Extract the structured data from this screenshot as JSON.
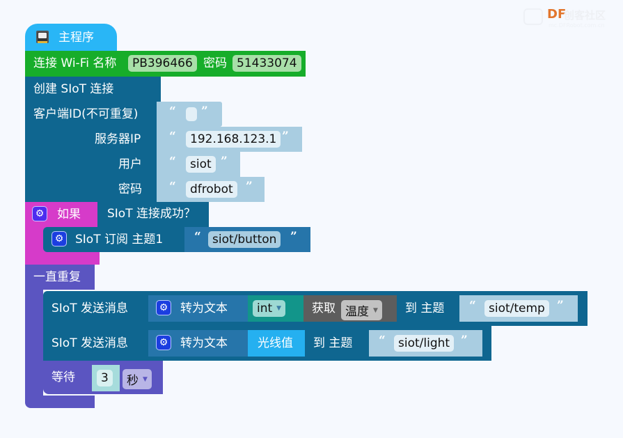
{
  "watermark": {
    "brand": "DF",
    "brand_cn": "创客社区",
    "url": "mc.DFRobot.com.cn",
    "brand_color": "#e2762d"
  },
  "program": {
    "main_label": "主程序",
    "main_icon": "microbit-board-icon",
    "wifi": {
      "prefix": "连接 Wi-Fi 名称",
      "ssid": "PB396466",
      "password_label": "密码",
      "password": "51433074"
    },
    "siot_connect": {
      "title": "创建 SIoT 连接",
      "client_id_label": "客户端ID(不可重复)",
      "client_id_value": "",
      "server_ip_label": "服务器IP",
      "server_ip_value": "192.168.123.1",
      "user_label": "用户",
      "user_value": "siot",
      "password_label": "密码",
      "password_value": "dfrobot"
    },
    "if_block": {
      "label": "如果",
      "condition": "SIoT 连接成功？",
      "subscribe_label": "SIoT 订阅 主题1",
      "subscribe_topic": "siot/button"
    },
    "forever": {
      "label": "一直重复",
      "send1": {
        "label": "SIoT 发送消息",
        "to_text": "转为文本",
        "type": "int",
        "get_label": "获取",
        "get_value": "温度",
        "to_topic": "到 主题",
        "topic": "siot/temp"
      },
      "send2": {
        "label": "SIoT 发送消息",
        "to_text": "转为文本",
        "value": "光线值",
        "to_topic": "到 主题",
        "topic": "siot/light"
      },
      "wait": {
        "label": "等待",
        "value": "3",
        "unit": "秒"
      }
    }
  },
  "quote_open": "“",
  "quote_close": "”"
}
